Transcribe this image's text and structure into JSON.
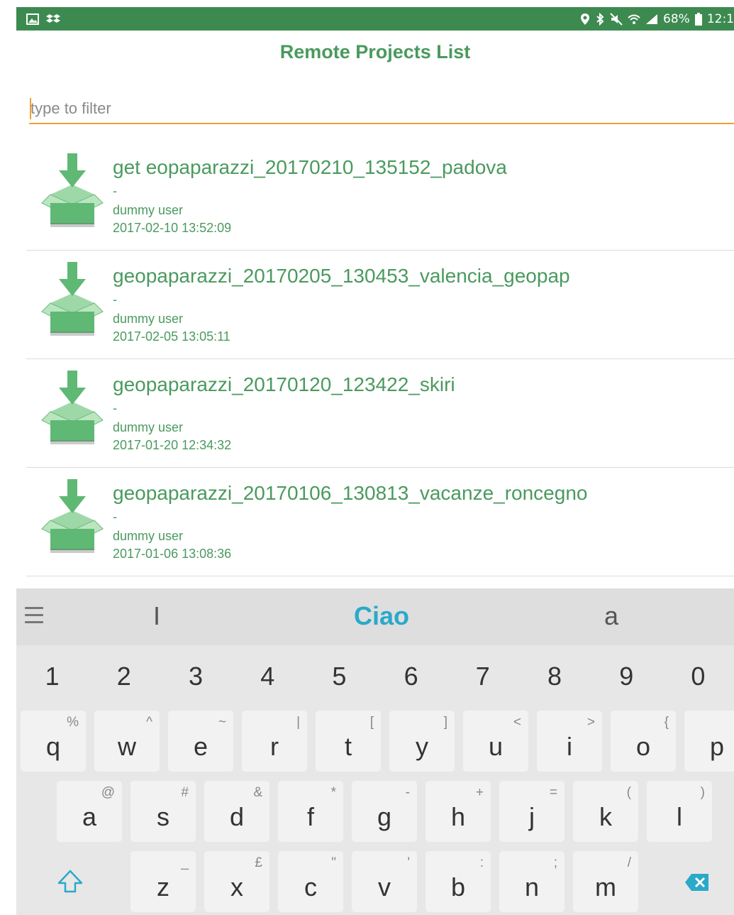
{
  "statusbar": {
    "battery": "68%",
    "time": "12:1",
    "left_icons": [
      "image-icon",
      "dropbox-icon"
    ],
    "right_icons": [
      "location-icon",
      "bluetooth-icon",
      "mute-icon",
      "wifi-icon",
      "signal-icon",
      "battery-icon"
    ]
  },
  "title": "Remote Projects List",
  "filter": {
    "placeholder": "type to filter",
    "value": ""
  },
  "projects": [
    {
      "name": "get eopaparazzi_20170210_135152_padova",
      "desc": "-",
      "user": "dummy user",
      "date": "2017-02-10 13:52:09"
    },
    {
      "name": "geopaparazzi_20170205_130453_valencia_geopap",
      "desc": "-",
      "user": "dummy user",
      "date": "2017-02-05 13:05:11"
    },
    {
      "name": "geopaparazzi_20170120_123422_skiri",
      "desc": "-",
      "user": "dummy user",
      "date": "2017-01-20 12:34:32"
    },
    {
      "name": "geopaparazzi_20170106_130813_vacanze_roncegno",
      "desc": "-",
      "user": "dummy user",
      "date": "2017-01-06 13:08:36"
    }
  ],
  "keyboard": {
    "suggestions": [
      "I",
      "Ciao",
      "a"
    ],
    "numbers": [
      "1",
      "2",
      "3",
      "4",
      "5",
      "6",
      "7",
      "8",
      "9",
      "0"
    ],
    "row1": [
      {
        "k": "q",
        "a": "%"
      },
      {
        "k": "w",
        "a": "^"
      },
      {
        "k": "e",
        "a": "~"
      },
      {
        "k": "r",
        "a": "|"
      },
      {
        "k": "t",
        "a": "["
      },
      {
        "k": "y",
        "a": "]"
      },
      {
        "k": "u",
        "a": "<"
      },
      {
        "k": "i",
        "a": ">"
      },
      {
        "k": "o",
        "a": "{"
      },
      {
        "k": "p",
        "a": "}"
      }
    ],
    "row2": [
      {
        "k": "a",
        "a": "@"
      },
      {
        "k": "s",
        "a": "#"
      },
      {
        "k": "d",
        "a": "&"
      },
      {
        "k": "f",
        "a": "*"
      },
      {
        "k": "g",
        "a": "-"
      },
      {
        "k": "h",
        "a": "+"
      },
      {
        "k": "j",
        "a": "="
      },
      {
        "k": "k",
        "a": "("
      },
      {
        "k": "l",
        "a": ")"
      }
    ],
    "row3": [
      {
        "k": "z",
        "a": "_"
      },
      {
        "k": "x",
        "a": "£"
      },
      {
        "k": "c",
        "a": "\""
      },
      {
        "k": "v",
        "a": "'"
      },
      {
        "k": "b",
        "a": ":"
      },
      {
        "k": "n",
        "a": ";"
      },
      {
        "k": "m",
        "a": "/"
      }
    ],
    "colors": {
      "accent": "#2aa9c9",
      "status_bar": "#3d8a50",
      "brand_green": "#4a9a5e",
      "filter_underline": "#f0a030"
    }
  }
}
